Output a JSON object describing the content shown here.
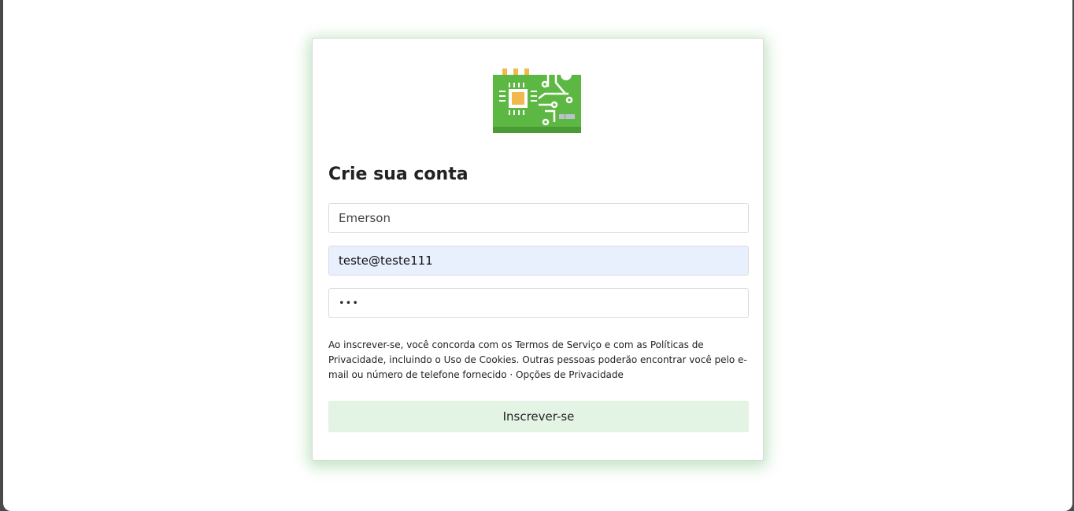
{
  "logo": {
    "icon": "circuit-board-icon"
  },
  "form": {
    "title": "Crie sua conta",
    "name_value": "Emerson",
    "email_value": "teste@teste111",
    "password_value": "•••",
    "terms_text": "Ao inscrever-se, você concorda com os Termos de Serviço e com as Políticas de Privacidade, incluindo o Uso de Cookies. Outras pessoas poderão encontrar você pelo e-mail ou número de telefone fornecido · Opções de Privacidade",
    "submit_label": "Inscrever-se"
  },
  "colors": {
    "accent_shadow": "#4caf50",
    "button_bg": "#e3f4e5",
    "autofill_bg": "#e8f0fe",
    "board_green": "#5db843"
  }
}
